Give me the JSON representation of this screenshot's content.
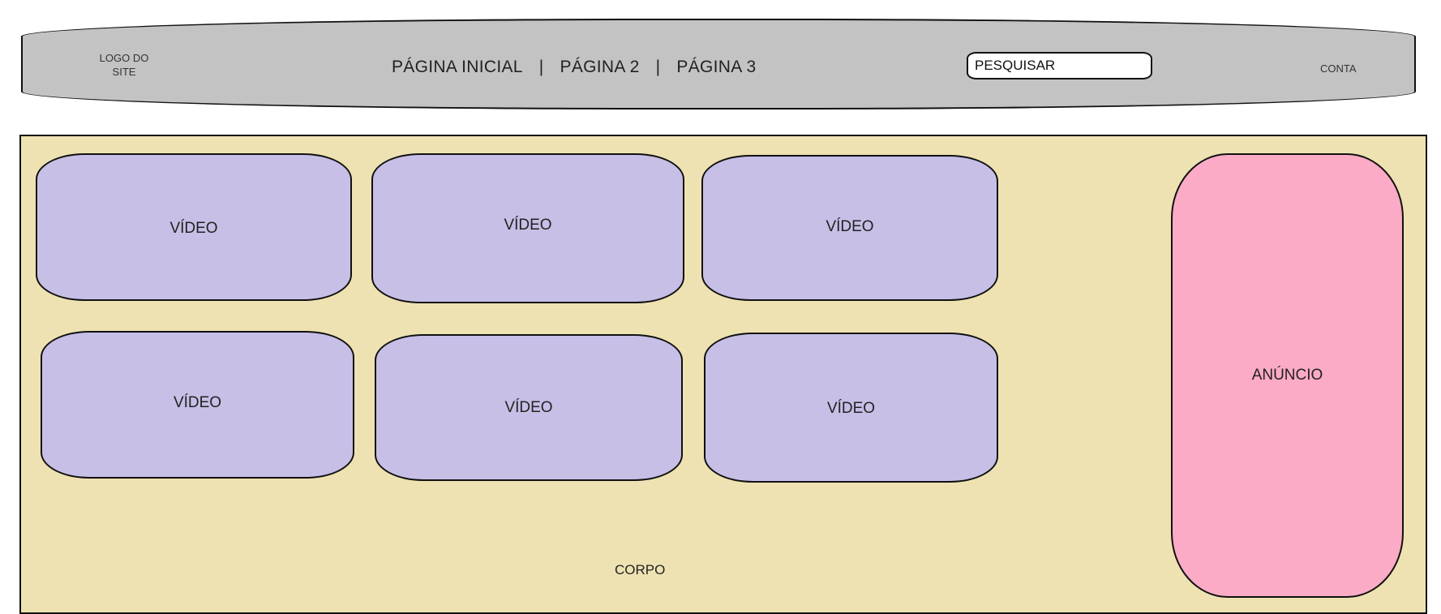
{
  "header": {
    "logo_line1": "LOGO DO",
    "logo_line2": "SITE",
    "nav": [
      {
        "label": "PÁGINA INICIAL"
      },
      {
        "label": "PÁGINA 2"
      },
      {
        "label": "PÁGINA 3"
      }
    ],
    "nav_separator": "|",
    "search_placeholder": "PESQUISAR",
    "account_label": "CONTA"
  },
  "body": {
    "label": "CORPO",
    "videos": [
      {
        "label": "VÍDEO"
      },
      {
        "label": "VÍDEO"
      },
      {
        "label": "VÍDEO"
      },
      {
        "label": "VÍDEO"
      },
      {
        "label": "VÍDEO"
      },
      {
        "label": "VÍDEO"
      }
    ],
    "ad_label": "ANÚNCIO"
  },
  "colors": {
    "header_bg": "#c3c3c3",
    "body_bg": "#eee2b2",
    "video_bg": "#c7bfe6",
    "ad_bg": "#fbabc5"
  }
}
